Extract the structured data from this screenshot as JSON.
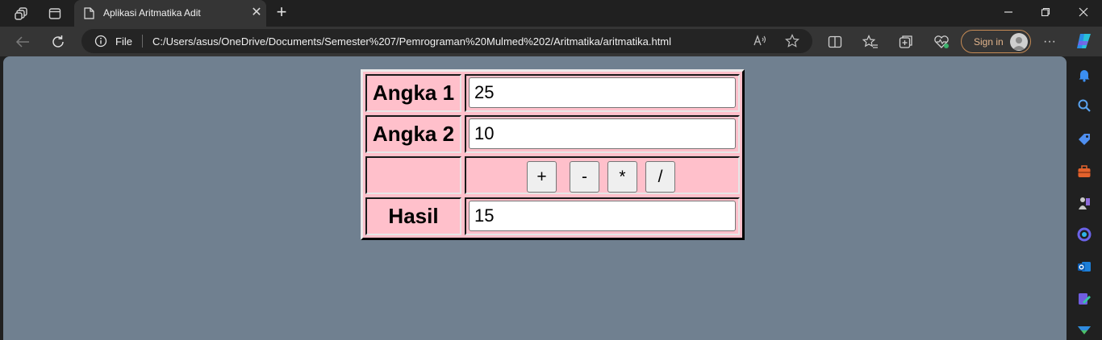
{
  "browser": {
    "tab": {
      "title": "Aplikasi Aritmatika Adit",
      "close": "✕"
    },
    "new_tab": "+",
    "address": {
      "scheme_label": "File",
      "url": "C:/Users/asus/OneDrive/Documents/Semester%207/Pemrograman%20Mulmed%202/Aritmatika/aritmatika.html"
    },
    "sign_in": "Sign in",
    "more": "···"
  },
  "calculator": {
    "label_angka1": "Angka 1",
    "label_angka2": "Angka 2",
    "label_hasil": "Hasil",
    "angka1_value": "25",
    "angka2_value": "10",
    "hasil_value": "15",
    "ops": [
      "+",
      "-",
      "*",
      "/"
    ]
  },
  "colors": {
    "page_bg": "#708090",
    "table_bg": "#ffc0cb"
  }
}
